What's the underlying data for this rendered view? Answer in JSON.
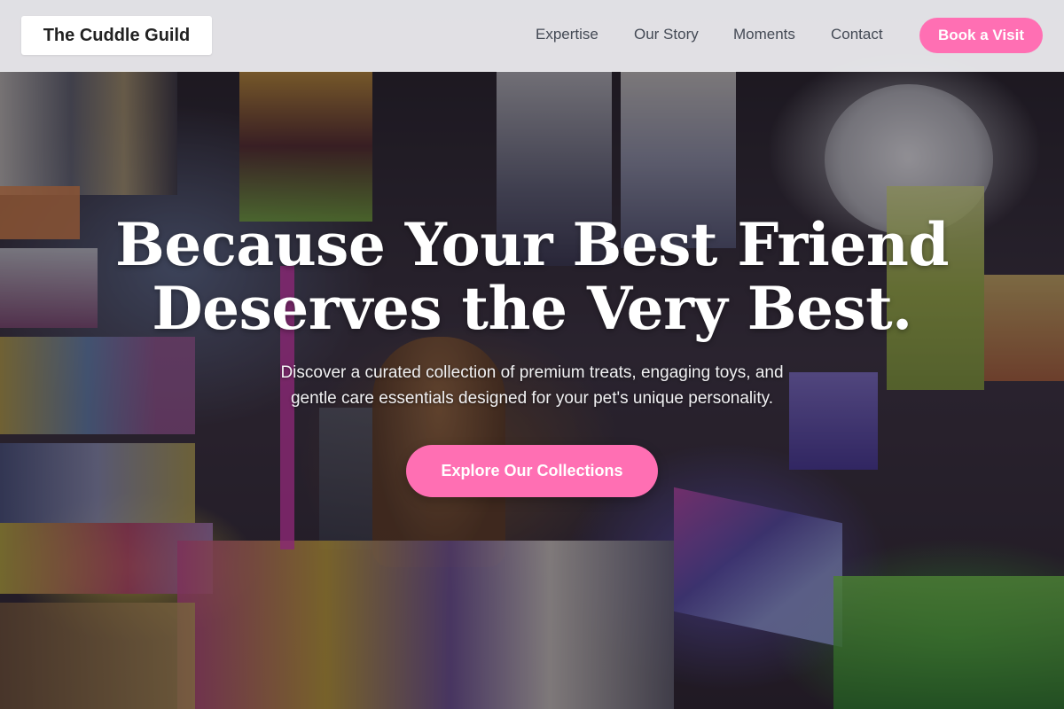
{
  "brand": {
    "name": "The Cuddle Guild"
  },
  "nav": {
    "links": [
      {
        "label": "Expertise"
      },
      {
        "label": "Our Story"
      },
      {
        "label": "Moments"
      },
      {
        "label": "Contact"
      }
    ],
    "cta_label": "Book a Visit"
  },
  "hero": {
    "title_line1": "Because Your Best Friend",
    "title_line2": "Deserves the Very Best.",
    "subtitle_line1": "Discover a curated collection of premium treats, engaging toys, and",
    "subtitle_line2": "gentle care essentials designed for your pet's unique personality.",
    "cta_label": "Explore Our Collections",
    "background_image": "dog-in-shop-photo"
  },
  "colors": {
    "accent": "#ff6fb3",
    "header_bg": "#f0f0f3",
    "hero_text": "#ffffff"
  }
}
